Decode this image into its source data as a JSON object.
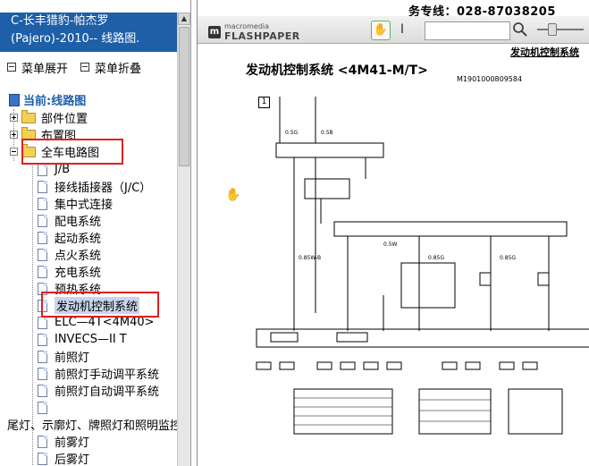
{
  "sidebar": {
    "title_line1": "C-长丰猎豹-帕杰罗",
    "title_line2": "(Pajero)-2010-- 线路图.",
    "expand_label": "菜单展开",
    "collapse_label": "菜单折叠",
    "current_label": "当前:线路图",
    "tree": [
      {
        "label": "部件位置",
        "kind": "folder",
        "state": "collapsed"
      },
      {
        "label": "布置图",
        "kind": "folder",
        "state": "collapsed"
      },
      {
        "label": "全车电路图",
        "kind": "folder",
        "state": "expanded"
      },
      {
        "label": "J/B",
        "kind": "doc"
      },
      {
        "label": "接线插接器（J/C）",
        "kind": "doc"
      },
      {
        "label": "集中式连接",
        "kind": "doc"
      },
      {
        "label": "配电系统",
        "kind": "doc"
      },
      {
        "label": "起动系统",
        "kind": "doc"
      },
      {
        "label": "点火系统",
        "kind": "doc"
      },
      {
        "label": "充电系统",
        "kind": "doc"
      },
      {
        "label": "预热系统",
        "kind": "doc"
      },
      {
        "label": "发动机控制系统",
        "kind": "doc",
        "selected": true
      },
      {
        "label": "ELC—4T<4M40>",
        "kind": "doc"
      },
      {
        "label": "INVECS—II T",
        "kind": "doc"
      },
      {
        "label": "前照灯",
        "kind": "doc"
      },
      {
        "label": "前照灯手动调平系统",
        "kind": "doc"
      },
      {
        "label": "前照灯自动调平系统",
        "kind": "doc"
      },
      {
        "label": "",
        "kind": "doc"
      },
      {
        "label": "尾灯、示廓灯、牌照灯和照明监控",
        "kind": "text"
      },
      {
        "label": "前雾灯",
        "kind": "doc"
      },
      {
        "label": "后雾灯",
        "kind": "doc"
      }
    ]
  },
  "viewer": {
    "hotline": "务专线：028-87038205",
    "brand_top": "macromedia",
    "brand_bottom": "FLASHPAPER",
    "search_value": "",
    "section_header": "发动机控制系统",
    "page_title": "发动机控制系统 <4M41-M/T>",
    "doc_code": "M1901000809584",
    "page_number": "1"
  },
  "colors": {
    "title_bg": "#1e5fa8",
    "highlight_box": "#e02020",
    "selection": "#c7d4ea"
  }
}
